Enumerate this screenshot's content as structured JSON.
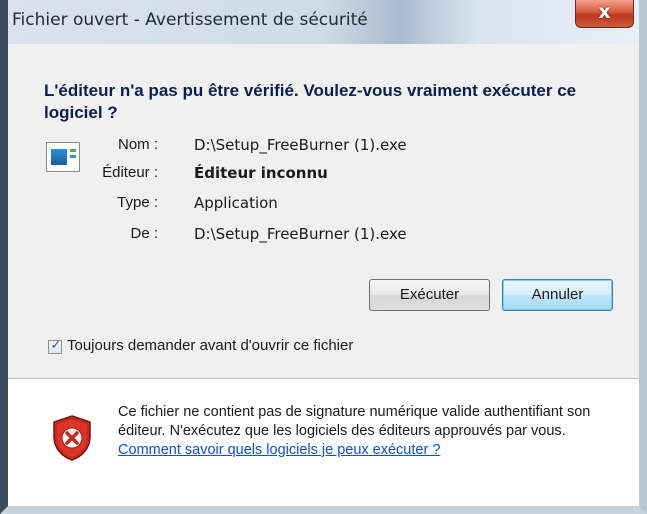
{
  "window": {
    "title": "Fichier ouvert - Avertissement de sécurité",
    "close_glyph": "x"
  },
  "dialog": {
    "heading": "L'éditeur n'a pas pu être vérifié. Voulez-vous vraiment exécuter ce logiciel ?",
    "fields": [
      {
        "label": "Nom :",
        "value": "D:\\Setup_FreeBurner (1).exe"
      },
      {
        "label": "Éditeur :",
        "value": "Éditeur inconnu"
      },
      {
        "label": "Type :",
        "value": "Application"
      },
      {
        "label": "De :",
        "value": "D:\\Setup_FreeBurner (1).exe"
      }
    ],
    "run_label": "Exécuter",
    "cancel_label": "Annuler",
    "checkbox_label": "Toujours demander avant d'ouvrir ce fichier",
    "checkbox_checked": true
  },
  "footer": {
    "warning_text": "Ce fichier ne contient pas de signature numérique valide authentifiant son éditeur. N'exécutez que les logiciels des éditeurs approuvés par vous.",
    "link_text": "Comment savoir quels logiciels je peux exécuter ?",
    "icon": "shield-error-icon"
  },
  "colors": {
    "heading": "#0b1f4f",
    "link": "#0f4fc8",
    "close_button": "#c9462c",
    "shield": "#c2281e"
  }
}
